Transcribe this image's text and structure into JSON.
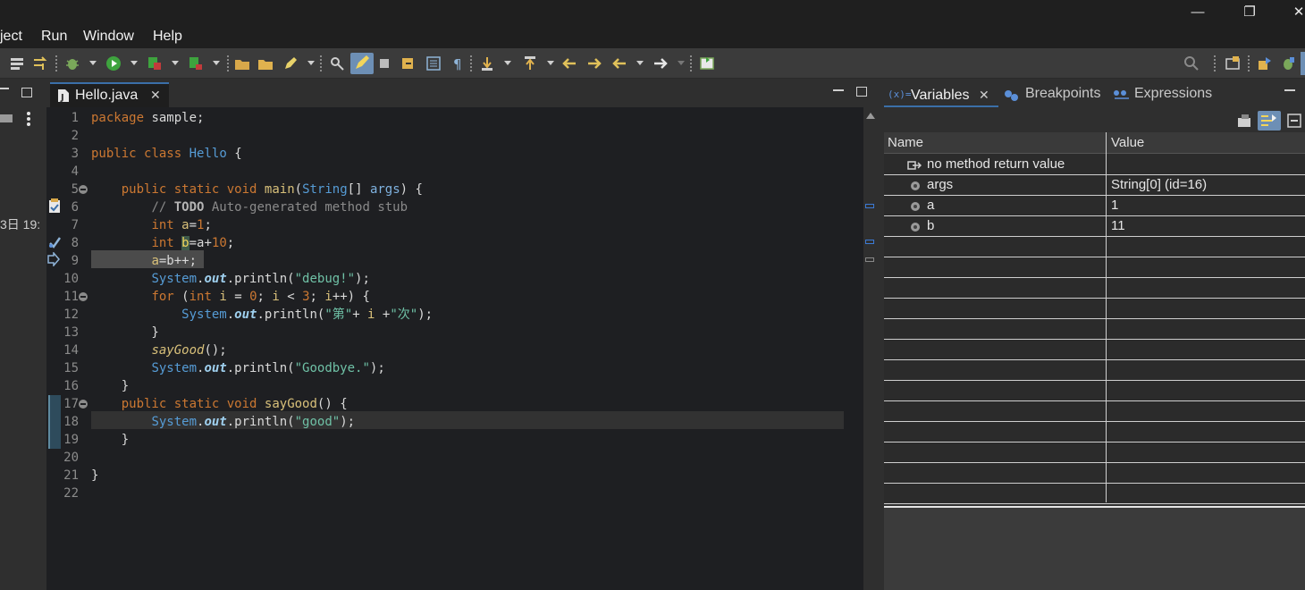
{
  "window": {
    "controls": {
      "minimize": "—",
      "restore": "❐",
      "close": "✕"
    }
  },
  "menu": {
    "items": [
      "ject",
      "Run",
      "Window",
      "Help"
    ]
  },
  "left_panel": {
    "date_fragment": "3日 19:"
  },
  "editor": {
    "tab_label": "Hello.java",
    "tab_close": "✕",
    "line_numbers": [
      "1",
      "2",
      "3",
      "4",
      "5",
      "6",
      "7",
      "8",
      "9",
      "10",
      "11",
      "12",
      "13",
      "14",
      "15",
      "16",
      "17",
      "18",
      "19",
      "20",
      "21",
      "22"
    ]
  },
  "debug_view": {
    "tabs": [
      {
        "label": "Variables",
        "icon": "variables-icon",
        "active": true
      },
      {
        "label": "Breakpoints",
        "icon": "breakpoints-icon",
        "active": false
      },
      {
        "label": "Expressions",
        "icon": "expressions-icon",
        "active": false
      }
    ],
    "tab_close": "✕",
    "columns": {
      "name": "Name",
      "value": "Value"
    },
    "rows": [
      {
        "name": "no method return value",
        "value": "",
        "icon": "return-value-icon"
      },
      {
        "name": "args",
        "value": "String[0]  (id=16)",
        "icon": "local-variable-icon"
      },
      {
        "name": "a",
        "value": "1",
        "icon": "local-variable-icon"
      },
      {
        "name": "b",
        "value": "11",
        "icon": "local-variable-icon"
      }
    ]
  },
  "colors": {
    "accent": "#3b6fa8",
    "keyword": "#cc7832",
    "type": "#569cd6",
    "string": "#6fc1a6"
  }
}
